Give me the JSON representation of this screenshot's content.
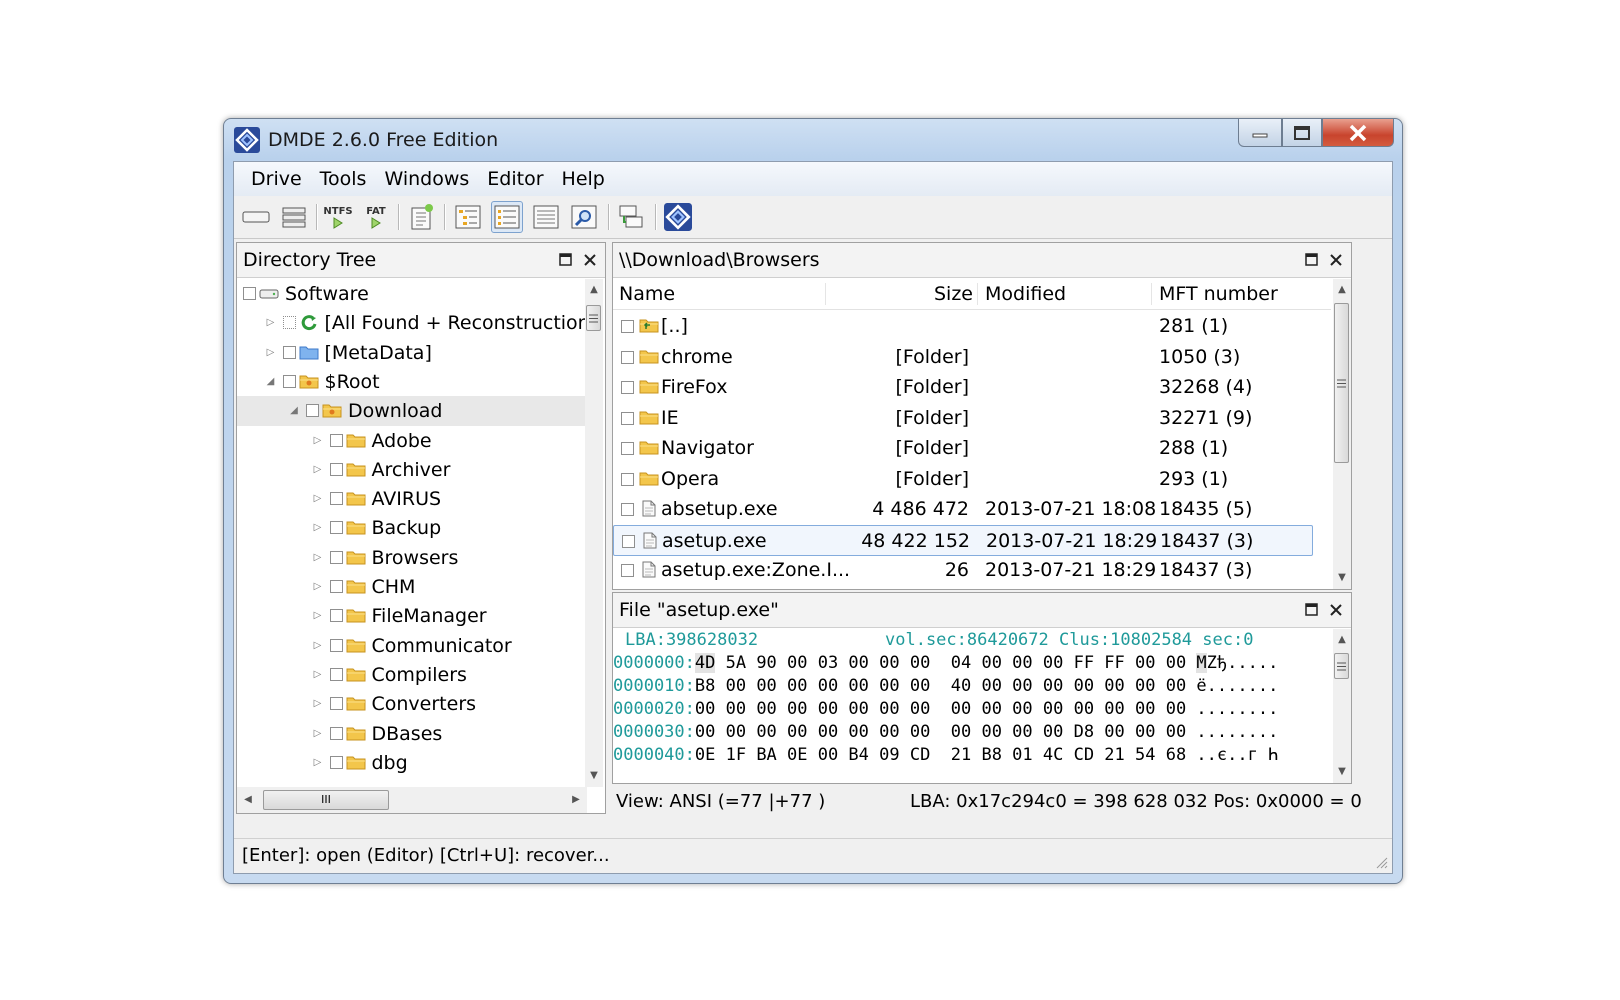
{
  "window": {
    "title": "DMDE 2.6.0 Free Edition"
  },
  "menu": [
    "Drive",
    "Tools",
    "Windows",
    "Editor",
    "Help"
  ],
  "toolbar": {
    "ntfs_label": "NTFS",
    "fat_label": "FAT",
    "buttons": [
      "drive-icon",
      "partitions-icon",
      "ntfs-open-icon",
      "fat-open-icon",
      "new-file-icon",
      "tree-icon",
      "list-icon",
      "details-icon",
      "search-icon",
      "recover-icon",
      "dmde-logo-icon"
    ],
    "pressed": "list-icon"
  },
  "directory_tree": {
    "title": "Directory Tree",
    "items": [
      {
        "label": "Software",
        "level": 0,
        "icon": "drive-icon",
        "expander": ""
      },
      {
        "label": "[All Found + Reconstruction]",
        "level": 1,
        "icon": "reconstruct-icon",
        "expander": "▷"
      },
      {
        "label": "[MetaData]",
        "level": 1,
        "icon": "folder-blue-icon",
        "expander": "▷"
      },
      {
        "label": "$Root",
        "level": 1,
        "icon": "folder-root-icon",
        "expander": "◢"
      },
      {
        "label": "Download",
        "level": 2,
        "icon": "folder-root-icon",
        "expander": "◢"
      },
      {
        "label": "Adobe",
        "level": 3,
        "icon": "folder-icon",
        "expander": "▷"
      },
      {
        "label": "Archiver",
        "level": 3,
        "icon": "folder-icon",
        "expander": "▷"
      },
      {
        "label": "AVIRUS",
        "level": 3,
        "icon": "folder-icon",
        "expander": "▷"
      },
      {
        "label": "Backup",
        "level": 3,
        "icon": "folder-icon",
        "expander": "▷"
      },
      {
        "label": "Browsers",
        "level": 3,
        "icon": "folder-icon",
        "expander": "▷"
      },
      {
        "label": "CHM",
        "level": 3,
        "icon": "folder-icon",
        "expander": "▷"
      },
      {
        "label": "FileManager",
        "level": 3,
        "icon": "folder-icon",
        "expander": "▷"
      },
      {
        "label": "Communicator",
        "level": 3,
        "icon": "folder-icon",
        "expander": "▷"
      },
      {
        "label": "Compilers",
        "level": 3,
        "icon": "folder-icon",
        "expander": "▷"
      },
      {
        "label": "Converters",
        "level": 3,
        "icon": "folder-icon",
        "expander": "▷"
      },
      {
        "label": "DBases",
        "level": 3,
        "icon": "folder-icon",
        "expander": "▷"
      },
      {
        "label": "dbg",
        "level": 3,
        "icon": "folder-icon",
        "expander": "▷"
      }
    ],
    "selected": "Download",
    "hscroll_thumb": "III"
  },
  "file_list": {
    "path": "\\\\Download\\Browsers",
    "columns": {
      "name": "Name",
      "size": "Size",
      "modified": "Modified",
      "mft": "MFT number"
    },
    "rows": [
      {
        "name": "[..]",
        "size": "",
        "modified": "",
        "mft": "281 (1)",
        "icon": "folder-up-icon"
      },
      {
        "name": "chrome",
        "size": "[Folder]",
        "modified": "",
        "mft": "1050 (3)",
        "icon": "folder-icon"
      },
      {
        "name": "FireFox",
        "size": "[Folder]",
        "modified": "",
        "mft": "32268 (4)",
        "icon": "folder-icon"
      },
      {
        "name": "IE",
        "size": "[Folder]",
        "modified": "",
        "mft": "32271 (9)",
        "icon": "folder-icon"
      },
      {
        "name": "Navigator",
        "size": "[Folder]",
        "modified": "",
        "mft": "288 (1)",
        "icon": "folder-icon"
      },
      {
        "name": "Opera",
        "size": "[Folder]",
        "modified": "",
        "mft": "293 (1)",
        "icon": "folder-icon"
      },
      {
        "name": "absetup.exe",
        "size": "4 486 472",
        "modified": "2013-07-21 18:08",
        "mft": "18435 (5)",
        "icon": "file-icon"
      },
      {
        "name": "asetup.exe",
        "size": "48 422 152",
        "modified": "2013-07-21 18:29",
        "mft": "18437 (3)",
        "icon": "file-icon"
      },
      {
        "name": "asetup.exe:Zone.I...",
        "size": "26",
        "modified": "2013-07-21 18:29",
        "mft": "18437 (3)",
        "icon": "file-icon"
      }
    ],
    "selected": "asetup.exe"
  },
  "hex_view": {
    "title": "File \"asetup.exe\"",
    "header_lba": "LBA:398628032",
    "header_right": "vol.sec:86420672 Clus:10802584 sec:0",
    "rows": [
      {
        "offset": "0000000:",
        "b1": "4D",
        "rest1": "5A 90 00 03 00 00 00",
        "bytes2": "04 00 00 00 FF FF 00 00",
        "ascii": "MZђ....."
      },
      {
        "offset": "0000010:",
        "b1": "B8",
        "rest1": "00 00 00 00 00 00 00",
        "bytes2": "40 00 00 00 00 00 00 00",
        "ascii": "ё......."
      },
      {
        "offset": "0000020:",
        "b1": "00",
        "rest1": "00 00 00 00 00 00 00",
        "bytes2": "00 00 00 00 00 00 00 00",
        "ascii": "........"
      },
      {
        "offset": "0000030:",
        "b1": "00",
        "rest1": "00 00 00 00 00 00 00",
        "bytes2": "00 00 00 00 D8 00 00 00",
        "ascii": "........"
      },
      {
        "offset": "0000040:",
        "b1": "0E",
        "rest1": "1F BA 0E 00 B4 09 CD",
        "bytes2": "21 B8 01 4C CD 21 54 68",
        "ascii": "..є..г Һ"
      }
    ],
    "view_mode": "View: ANSI (=77 |+77 )",
    "position": "LBA: 0x17c294c0 = 398 628 032  Pos: 0x0000 = 0"
  },
  "statusbar": {
    "text": "[Enter]: open (Editor)  [Ctrl+U]: recover..."
  }
}
